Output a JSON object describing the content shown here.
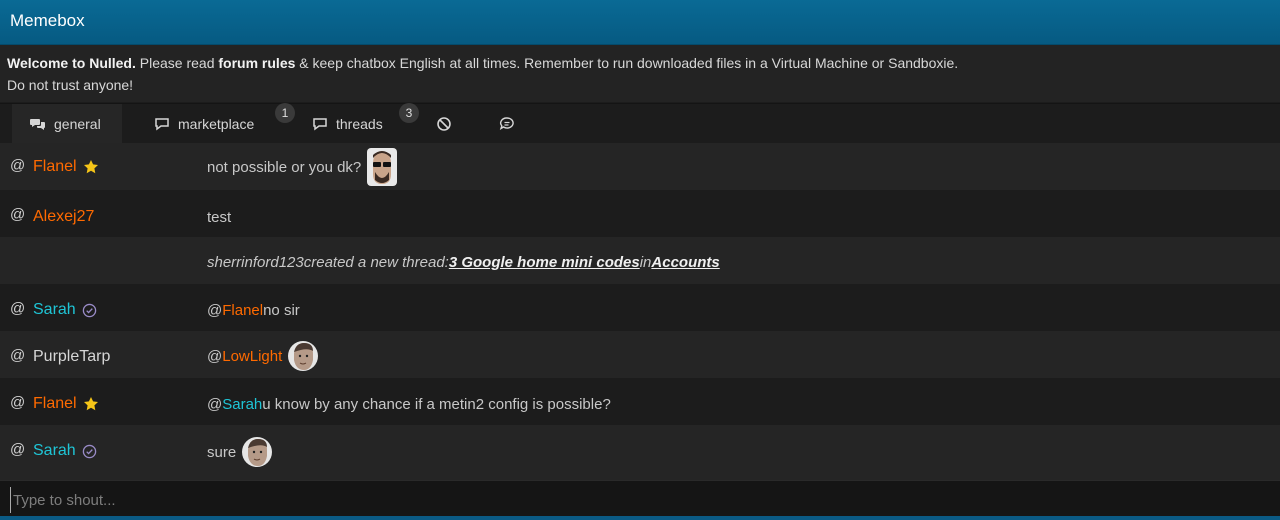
{
  "header": {
    "title": "Memebox"
  },
  "notice": {
    "welcome": "Welcome to Nulled.",
    "please_read": " Please read ",
    "rules_link": "forum rules",
    "rest": " & keep chatbox English at all times. Remember to run downloaded files in a Virtual Machine or Sandboxie.",
    "line2": "Do not trust anyone!"
  },
  "tabs": [
    {
      "label": "general",
      "icon": "comments-icon",
      "active": true
    },
    {
      "label": "marketplace",
      "icon": "comment-icon",
      "badge": "1"
    },
    {
      "label": "threads",
      "icon": "comment-icon",
      "badge": "3"
    },
    {
      "label": "",
      "icon": "ban-icon"
    },
    {
      "label": "",
      "icon": "chat-bubble-icon"
    }
  ],
  "messages": [
    {
      "at": "@",
      "user": "Flanel",
      "user_color": "#ff6a00",
      "badge": "star-icon",
      "text": "not possible or you dk?",
      "emote": "sunglasses-face-emote"
    },
    {
      "at": "@",
      "user": "Alexej27",
      "user_color": "#ff6a00",
      "text": "test"
    },
    {
      "system": true,
      "actor": "sherrinford123",
      "action": " created a new thread: ",
      "thread": "3 Google home mini codes",
      "in": " in ",
      "forum": "Accounts"
    },
    {
      "at": "@",
      "user": "Sarah",
      "user_color": "#1fc5d6",
      "badge": "verified-icon",
      "mention": "@",
      "mention_user": "Flanel",
      "text": " no sir"
    },
    {
      "at": "@",
      "user": "PurpleTarp",
      "user_color": "#d6d6d6",
      "mention": "@",
      "mention_user": "LowLight",
      "emote": "face-emote"
    },
    {
      "at": "@",
      "user": "Flanel",
      "user_color": "#ff6a00",
      "badge": "star-icon",
      "mention": "@",
      "mention_user": "Sarah",
      "text": " u know by any chance if a metin2 config is possible?"
    },
    {
      "at": "@",
      "user": "Sarah",
      "user_color": "#1fc5d6",
      "badge": "verified-icon",
      "text": "sure",
      "emote": "face-emote"
    }
  ],
  "input": {
    "placeholder": "Type to shout..."
  },
  "colors": {
    "header": "#065a82",
    "orange": "#ff6a00",
    "cyan": "#1fc5d6"
  }
}
